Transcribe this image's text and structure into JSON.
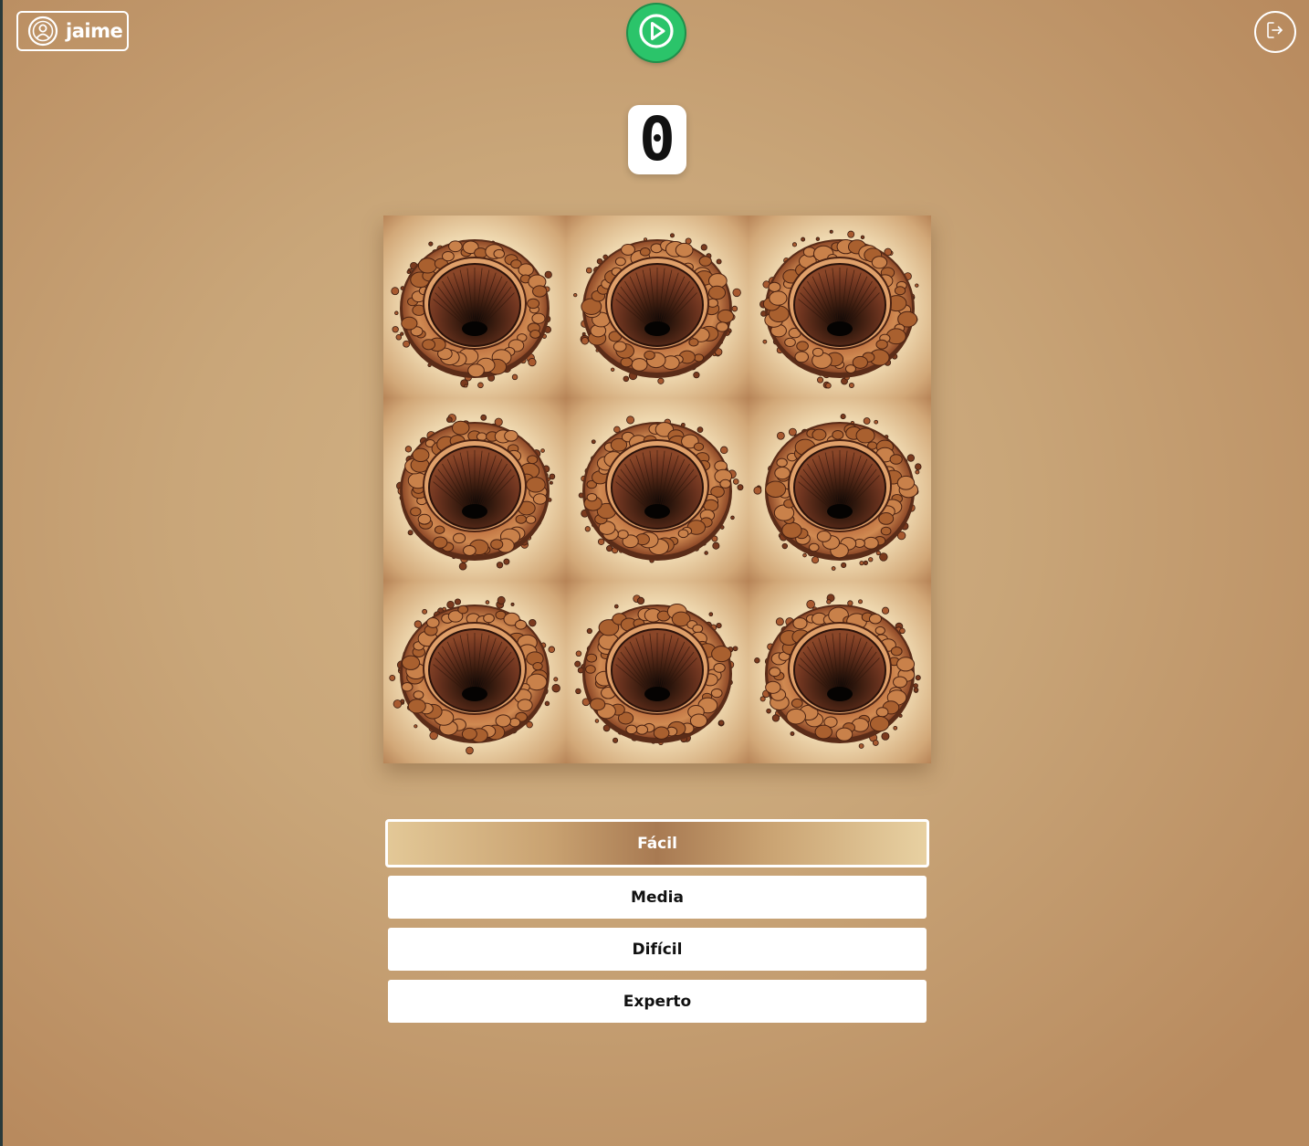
{
  "header": {
    "user": {
      "icon": "user-circle-icon",
      "name": "jaime"
    },
    "play_icon": "play-icon",
    "play_color": "#2bc46a",
    "logout_icon": "logout-icon"
  },
  "score": "0",
  "board": {
    "rows": 3,
    "cols": 3,
    "cell_image": "dirt-hole",
    "cells": [
      "hole",
      "hole",
      "hole",
      "hole",
      "hole",
      "hole",
      "hole",
      "hole",
      "hole"
    ]
  },
  "difficulty": {
    "selected": "Fácil",
    "options": [
      {
        "label": "Fácil",
        "active": true
      },
      {
        "label": "Media",
        "active": false
      },
      {
        "label": "Difícil",
        "active": false
      },
      {
        "label": "Experto",
        "active": false
      }
    ]
  }
}
